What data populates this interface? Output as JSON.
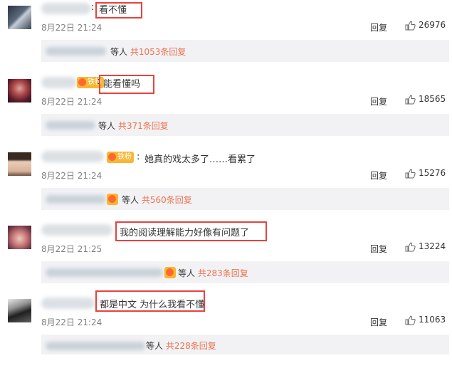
{
  "comments": [
    {
      "text": "看不懂",
      "time": "8月22日 21:24",
      "reply_label": "回复",
      "likes": "26976",
      "sub_people": "等人",
      "sub_count": "共1053条回复",
      "badge": ""
    },
    {
      "text": "能看懂吗",
      "time": "8月22日 21:24",
      "reply_label": "回复",
      "likes": "18565",
      "sub_people": "等人",
      "sub_count": "共371条回复",
      "badge": "铁粉"
    },
    {
      "text": "她真的戏太多了……看累了",
      "time": "8月22日 21:24",
      "reply_label": "回复",
      "likes": "15276",
      "sub_people": "等人",
      "sub_count": "共560条回复",
      "badge": "铁粉"
    },
    {
      "text": "我的阅读理解能力好像有问题了",
      "time": "8月22日 21:25",
      "reply_label": "回复",
      "likes": "13224",
      "sub_people": "等人",
      "sub_count": "共283条回复",
      "badge": ""
    },
    {
      "text": "都是中文 为什么我看不懂",
      "time": "8月22日 21:24",
      "reply_label": "回复",
      "likes": "11063",
      "sub_people": "等人",
      "sub_count": "共228条回复",
      "badge": ""
    }
  ],
  "colors": {
    "highlight_box": "#e8413d",
    "link": "#eb7350",
    "subbox_bg": "#f2f2f5",
    "badge": "#f7b733"
  },
  "icons": {
    "like": "thumbs-up-icon"
  }
}
